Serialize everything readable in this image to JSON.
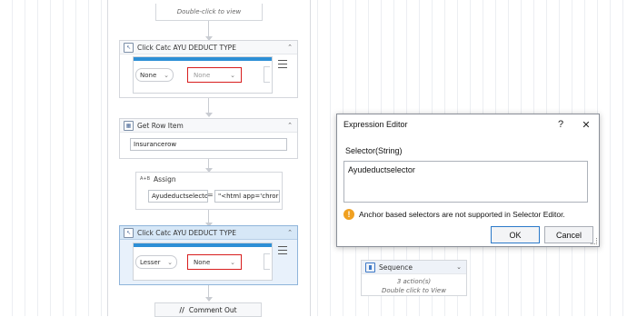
{
  "workflow": {
    "top_hint": "Double-click to view",
    "click1": {
      "title": "Click Catc AYU DEDUCT TYPE",
      "left_select": "None",
      "red_select": "None"
    },
    "get_row": {
      "title": "Get Row Item",
      "value": "Insurancerow"
    },
    "assign": {
      "icon": "A+B",
      "title": "Assign",
      "target": "Ayudeductselector",
      "equals": "=",
      "value": "\"<html app='chror"
    },
    "click2": {
      "title": "Click Catc AYU DEDUCT TYPE",
      "left_select": "Lesser",
      "red_select": "None"
    },
    "comment_out": {
      "title": "Comment Out"
    },
    "sequence": {
      "title": "Sequence",
      "actions": "3 action(s)",
      "hint": "Double click to View"
    }
  },
  "dialog": {
    "title": "Expression Editor",
    "help": "?",
    "close": "✕",
    "label": "Selector(String)",
    "expression": "Ayudeductselector",
    "warning_icon": "!",
    "warning": "Anchor based selectors are not supported in Selector Editor.",
    "ok": "OK",
    "cancel": "Cancel"
  },
  "colors": {
    "selection_blue": "#d6e7f7",
    "browser_bar": "#2d8fd6",
    "highlight_red": "#d81e1e",
    "warning_orange": "#f0a020"
  }
}
